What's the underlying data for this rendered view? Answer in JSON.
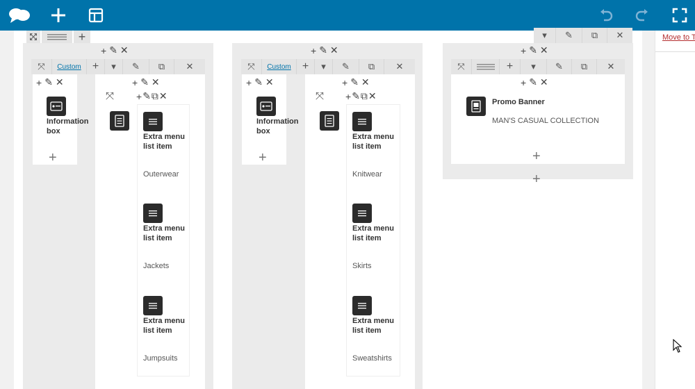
{
  "toolbar": {
    "icons": [
      "cloud-logo-icon",
      "add-icon",
      "layout-icon",
      "undo-icon",
      "redo-icon",
      "fullscreen-icon"
    ]
  },
  "side_panel": {
    "link": "Move to T"
  },
  "columns": [
    {
      "custom_label": "Custom",
      "info_box": {
        "title": "Information box"
      },
      "menu_items": [
        {
          "title": "Extra menu list item",
          "value": "Outerwear"
        },
        {
          "title": "Extra menu list item",
          "value": "Jackets"
        },
        {
          "title": "Extra menu list item",
          "value": "Jumpsuits"
        }
      ]
    },
    {
      "custom_label": "Custom",
      "info_box": {
        "title": "Information box"
      },
      "menu_items": [
        {
          "title": "Extra menu list item",
          "value": "Knitwear"
        },
        {
          "title": "Extra menu list item",
          "value": "Skirts"
        },
        {
          "title": "Extra menu list item",
          "value": "Sweatshirts"
        }
      ]
    }
  ],
  "promo": {
    "title": "Promo Banner",
    "subtitle": "MAN'S CASUAL COLLECTION"
  },
  "colors": {
    "toolbar": "#0073aa",
    "link": "#0073aa",
    "icon_bg": "#2b2b2b"
  }
}
